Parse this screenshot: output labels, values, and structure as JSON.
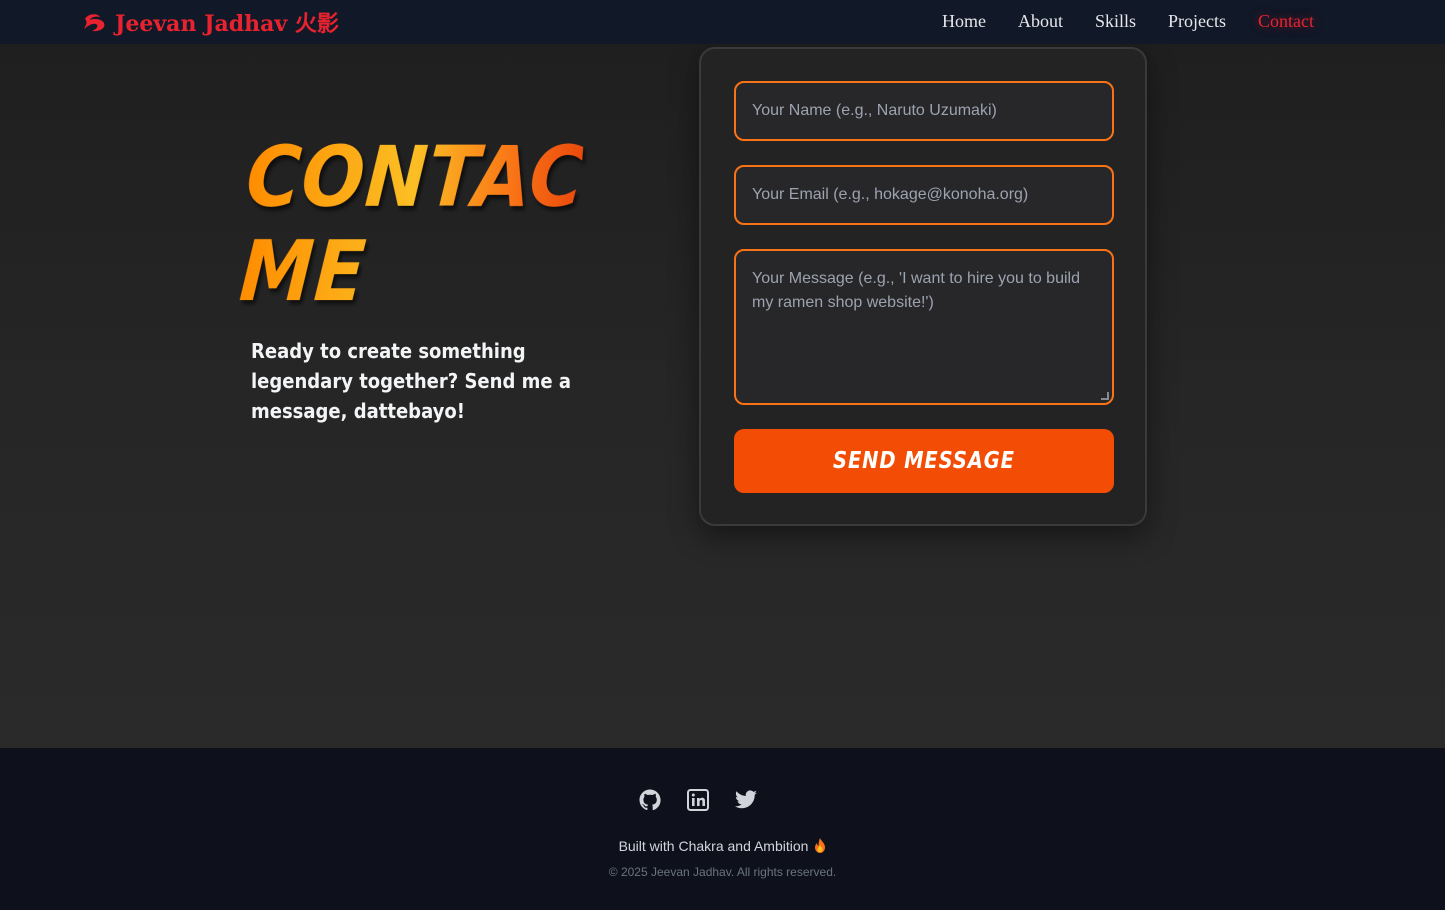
{
  "nav": {
    "brand": "Jeevan Jadhav 火影",
    "brand_icon": "swirl-icon",
    "links": [
      {
        "label": "Home",
        "active": false
      },
      {
        "label": "About",
        "active": false
      },
      {
        "label": "Skills",
        "active": false
      },
      {
        "label": "Projects",
        "active": false
      },
      {
        "label": "Contact",
        "active": true
      }
    ]
  },
  "contact": {
    "heading_line1": "CONTACT",
    "heading_line2": "ME",
    "subtext": "Ready to create something legendary together? Send me a message, dattebayo!"
  },
  "form": {
    "name_placeholder": "Your Name (e.g., Naruto Uzumaki)",
    "email_placeholder": "Your Email (e.g., hokage@konoha.org)",
    "message_placeholder": "Your Message (e.g., 'I want to hire you to build my ramen shop website!')",
    "submit_label": "SEND MESSAGE"
  },
  "footer": {
    "social_icons": [
      "github-icon",
      "linkedin-icon",
      "twitter-icon"
    ],
    "built_with": "Built with Chakra and Ambition",
    "copyright": "© 2025 Jeevan Jadhav. All rights reserved."
  },
  "colors": {
    "accent_red": "#e8232f",
    "accent_orange": "#f97316",
    "button": "#f24c05",
    "nav_bg": "#111827",
    "footer_bg": "#0e111c"
  }
}
